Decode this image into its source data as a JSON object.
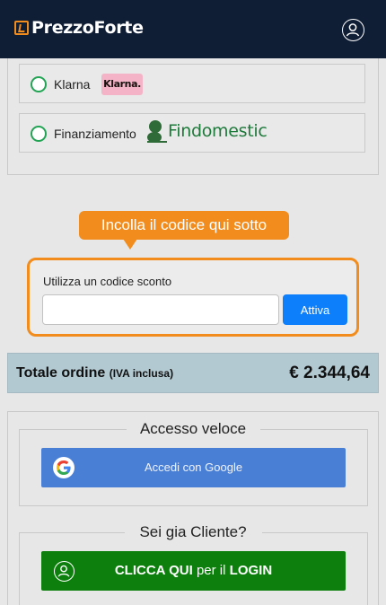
{
  "header": {
    "brand": "PrezzoForte",
    "logo_icon": "prezzoforte-logo-icon",
    "user_icon": "user-icon"
  },
  "payment": {
    "options": [
      {
        "label": "Klarna",
        "badge": "Klarna."
      },
      {
        "label": "Finanziamento",
        "badge": "Findomestic"
      }
    ]
  },
  "coupon": {
    "tooltip": "Incolla il codice qui sotto",
    "label": "Utilizza un codice sconto",
    "input_value": "",
    "placeholder": "",
    "activate_label": "Attiva"
  },
  "total": {
    "label": "Totale ordine",
    "sublabel": "(IVA inclusa)",
    "value": "€ 2.344,64"
  },
  "login": {
    "quick_title": "Accesso veloce",
    "google_label": "Accedi con Google",
    "client_title": "Sei gia Cliente?",
    "cta_bold_1": "CLICCA QUI",
    "cta_mid": " per il ",
    "cta_bold_2": "LOGIN"
  },
  "colors": {
    "header_bg": "#0f1d35",
    "accent_orange": "#f28c1c",
    "radio_green": "#23a455",
    "activate_blue": "#0d7ffb",
    "google_blue": "#4a7fd6",
    "login_green": "#0c7f0c",
    "total_bg": "#b3c9d1"
  }
}
